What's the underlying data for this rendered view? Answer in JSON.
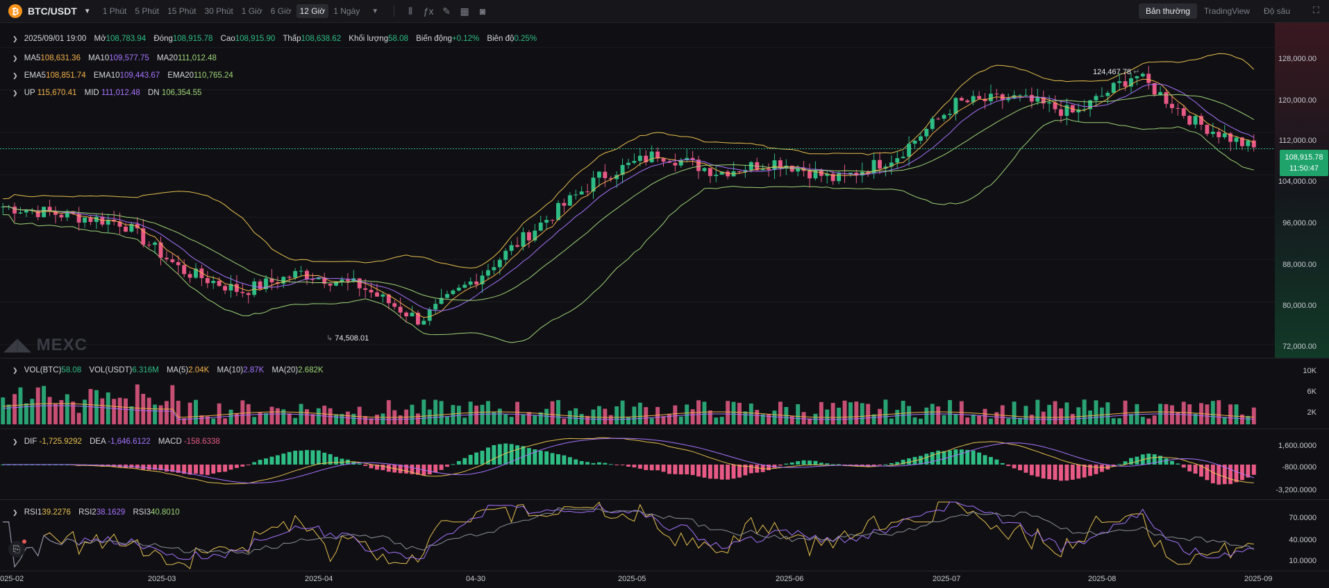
{
  "toolbar": {
    "coin_glyph": "₿",
    "pair": "BTC/USDT",
    "timeframes": [
      "1 Phút",
      "5 Phút",
      "15 Phút",
      "30 Phút",
      "1 Giờ",
      "6 Giờ",
      "12 Giờ",
      "1 Ngày"
    ],
    "active_timeframe": "12 Giờ",
    "modes": [
      "Bản thường",
      "TradingView",
      "Độ sâu"
    ],
    "active_mode": "Bản thường"
  },
  "ohlc": {
    "date": "2025/09/01 19:00",
    "open_label": "Mở",
    "open": "108,783.94",
    "close_label": "Đóng",
    "close": "108,915.78",
    "high_label": "Cao",
    "high": "108,915.90",
    "low_label": "Thấp",
    "low": "108,638.62",
    "volume_label": "Khối lượng",
    "volume": "58.08",
    "change_label": "Biến động",
    "change": "+0.12%",
    "amplitude_label": "Biên độ",
    "amplitude": "0.25%"
  },
  "ma": {
    "ma5_label": "MA5",
    "ma5": "108,631.36",
    "ma10_label": "MA10",
    "ma10": "109,577.75",
    "ma20_label": "MA20",
    "ma20": "111,012.48"
  },
  "ema": {
    "ema5_label": "EMA5",
    "ema5": "108,851.74",
    "ema10_label": "EMA10",
    "ema10": "109,443.67",
    "ema20_label": "EMA20",
    "ema20": "110,765.24"
  },
  "boll": {
    "up_label": "UP",
    "up": "115,670.41",
    "mid_label": "MID",
    "mid": "111,012.48",
    "dn_label": "DN",
    "dn": "106,354.55"
  },
  "vol": {
    "btc_label": "VOL(BTC)",
    "btc": "58.08",
    "usdt_label": "VOL(USDT)",
    "usdt": "6.316M",
    "ma5_label": "MA(5)",
    "ma5": "2.04K",
    "ma10_label": "MA(10)",
    "ma10": "2.87K",
    "ma20_label": "MA(20)",
    "ma20": "2.682K"
  },
  "macd": {
    "dif_label": "DIF",
    "dif": "-1,725.9292",
    "dea_label": "DEA",
    "dea": "-1,646.6122",
    "macd_label": "MACD",
    "macd": "-158.6338"
  },
  "rsi": {
    "rsi1_label": "RSI1",
    "rsi1": "39.2276",
    "rsi2_label": "RSI2",
    "rsi2": "38.1629",
    "rsi3_label": "RSI3",
    "rsi3": "40.8010"
  },
  "price_axis": [
    "128,000.00",
    "120,000.00",
    "112,000.00",
    "104,000.00",
    "96,000.00",
    "88,000.00",
    "80,000.00",
    "72,000.00"
  ],
  "vol_axis": [
    "10K",
    "6K",
    "2K"
  ],
  "macd_axis": [
    "1,600.0000",
    "-800.0000",
    "-3,200.0000"
  ],
  "rsi_axis": [
    "70.0000",
    "40.0000",
    "10.0000"
  ],
  "x_axis": [
    "025-02",
    "2025-03",
    "2025-04",
    "04-30",
    "2025-05",
    "2025-06",
    "2025-07",
    "2025-08",
    "2025-09"
  ],
  "current_price": {
    "price": "108,915.78",
    "countdown": "11:50:47"
  },
  "annotations": {
    "high": "124,467.78",
    "low": "74,508.01"
  },
  "watermark": "MEXC",
  "colors": {
    "up": "#2ebd85",
    "down": "#e85a85",
    "ma5": "#f5b14a",
    "ma10": "#a673ff",
    "ma20": "#9ed476",
    "boll": "#e8c04d"
  },
  "chart_data": {
    "type": "candlestick",
    "interval": "12 Giờ",
    "ylim": [
      70000,
      132000
    ],
    "x_ticks": [
      "2025-02",
      "2025-03",
      "2025-04",
      "04-30",
      "2025-05",
      "2025-06",
      "2025-07",
      "2025-08",
      "2025-09"
    ],
    "x": [
      "2025-02-01",
      "2025-02-10",
      "2025-02-20",
      "2025-03-01",
      "2025-03-10",
      "2025-03-20",
      "2025-04-01",
      "2025-04-08",
      "2025-04-20",
      "2025-04-30",
      "2025-05-10",
      "2025-05-20",
      "2025-06-01",
      "2025-06-10",
      "2025-06-20",
      "2025-07-01",
      "2025-07-10",
      "2025-07-20",
      "2025-08-01",
      "2025-08-14",
      "2025-08-20",
      "2025-09-01"
    ],
    "close": [
      98000,
      96500,
      95000,
      86000,
      82000,
      85500,
      83000,
      76500,
      85000,
      94500,
      103500,
      108000,
      104500,
      106500,
      103000,
      107500,
      117500,
      118500,
      115500,
      123000,
      114000,
      108915
    ],
    "high_annotation": 124467.78,
    "low_annotation": 74508.01
  }
}
